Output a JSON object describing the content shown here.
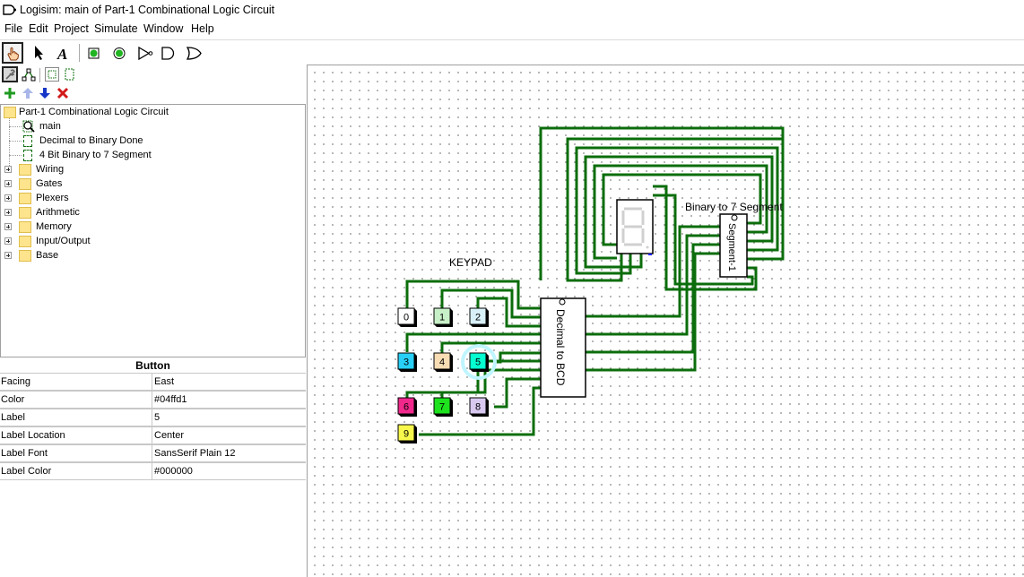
{
  "window": {
    "title": "Logisim: main of Part-1 Combinational Logic Circuit"
  },
  "menu": [
    "File",
    "Edit",
    "Project",
    "Simulate",
    "Window",
    "Help"
  ],
  "toolbar": {
    "tools": [
      "hand-poke-tool",
      "select-tool",
      "text-tool",
      "input-pin-tool",
      "output-pin-tool",
      "not-gate-tool",
      "and-gate-tool",
      "or-gate-tool"
    ]
  },
  "explorer": {
    "project": "Part-1 Combinational Logic Circuit",
    "circuits": [
      "main",
      "Decimal to Binary Done",
      "4 Bit Binary to 7 Segment"
    ],
    "libraries": [
      "Wiring",
      "Gates",
      "Plexers",
      "Arithmetic",
      "Memory",
      "Input/Output",
      "Base"
    ]
  },
  "properties": {
    "title": "Button",
    "rows": [
      {
        "key": "Facing",
        "value": "East"
      },
      {
        "key": "Color",
        "value": "#04ffd1"
      },
      {
        "key": "Label",
        "value": "5"
      },
      {
        "key": "Label Location",
        "value": "Center"
      },
      {
        "key": "Label Font",
        "value": "SansSerif Plain 12"
      },
      {
        "key": "Label Color",
        "value": "#000000"
      }
    ]
  },
  "canvas": {
    "keypad_label": "KEYPAD",
    "bcd_label": "Decimal to BCD",
    "seg_block_label": "Segment-1",
    "seg_block_title": "Binary to 7 Segment",
    "wire_color": "#0b6d0b",
    "buttons": [
      {
        "label": "0",
        "color": "#ffffff"
      },
      {
        "label": "1",
        "color": "#c8f0c8"
      },
      {
        "label": "2",
        "color": "#d8f0f8"
      },
      {
        "label": "3",
        "color": "#28d0f8"
      },
      {
        "label": "4",
        "color": "#f8dcb4"
      },
      {
        "label": "5",
        "color": "#04ffd1"
      },
      {
        "label": "6",
        "color": "#f0288c"
      },
      {
        "label": "7",
        "color": "#1ee21e"
      },
      {
        "label": "8",
        "color": "#d8c8f0"
      },
      {
        "label": "9",
        "color": "#f8f84c"
      }
    ]
  }
}
